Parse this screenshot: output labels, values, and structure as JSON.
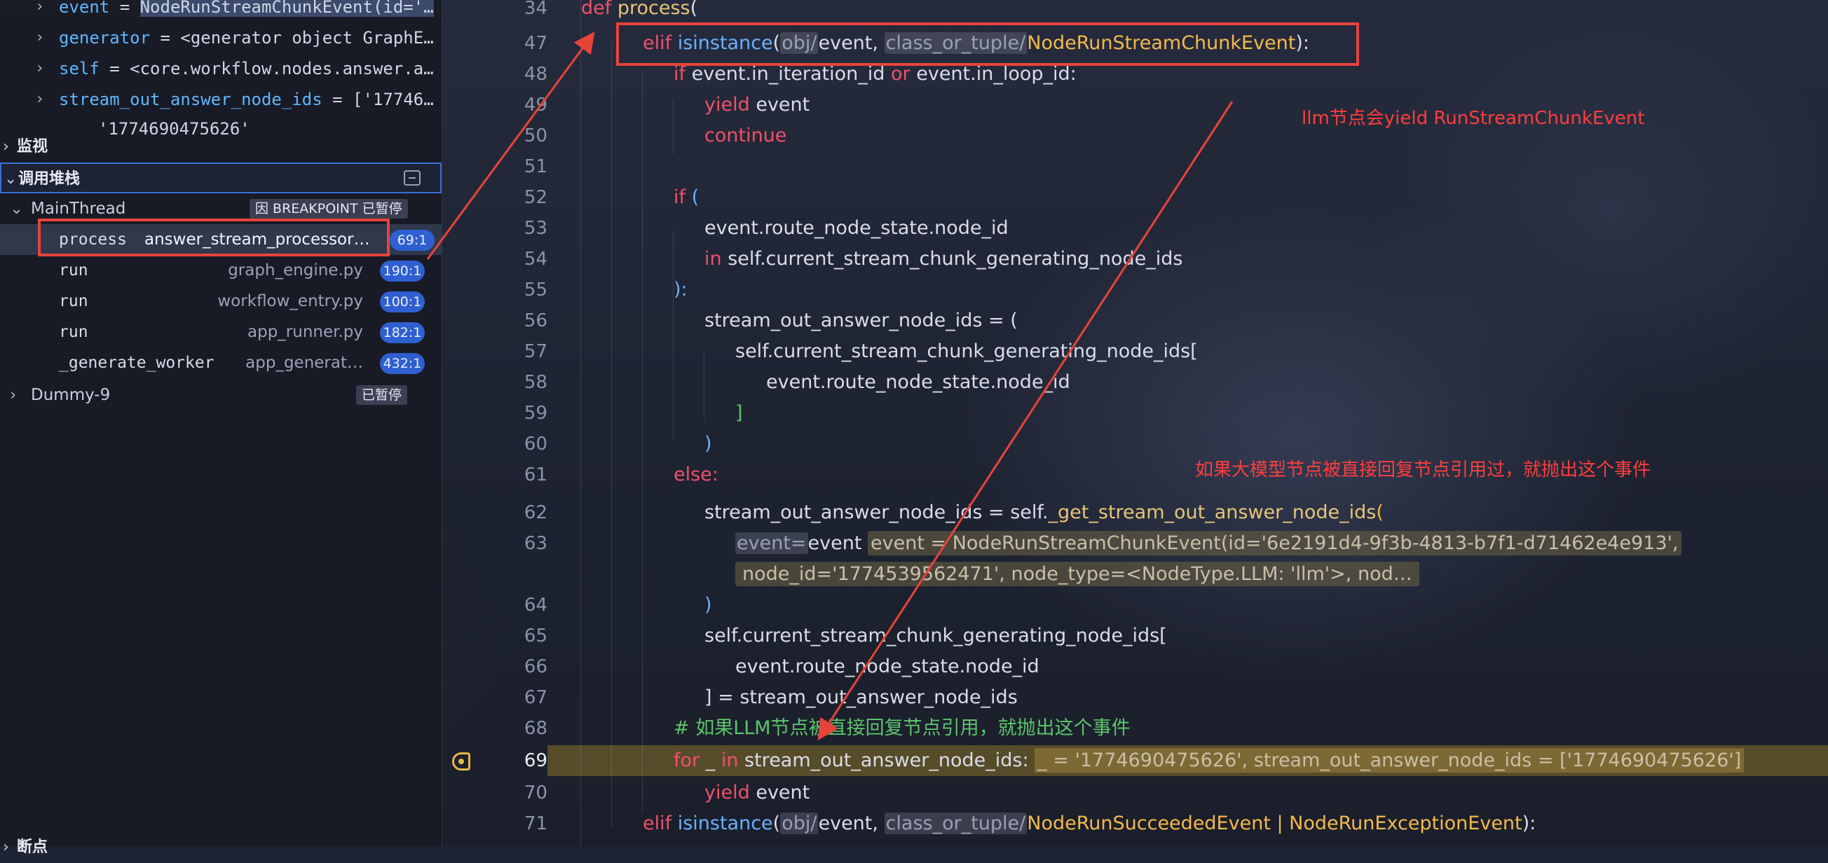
{
  "variables": [
    {
      "name": "event",
      "value": "NodeRunStreamChunkEvent(id='…"
    },
    {
      "name": "generator",
      "value": "<generator object GraphE…"
    },
    {
      "name": "self",
      "value": "<core.workflow.nodes.answer.a…"
    },
    {
      "name": "stream_out_answer_node_ids",
      "value": "['17746…"
    },
    {
      "name": "",
      "value": "'1774690475626'"
    }
  ],
  "sections": {
    "watch": "监视",
    "callstack": "调用堆栈",
    "breakpoints": "断点"
  },
  "threads": {
    "main": {
      "name": "MainThread",
      "status": "因 BREAKPOINT 已暂停"
    },
    "dummy": {
      "name": "Dummy-9",
      "status": "已暂停"
    }
  },
  "frames": [
    {
      "fn": "process",
      "file": "answer_stream_processor…",
      "line": "69:1"
    },
    {
      "fn": "run",
      "file": "graph_engine.py",
      "line": "190:1"
    },
    {
      "fn": "run",
      "file": "workflow_entry.py",
      "line": "100:1"
    },
    {
      "fn": "run",
      "file": "app_runner.py",
      "line": "182:1"
    },
    {
      "fn": "_generate_worker",
      "file": "app_generat…",
      "line": "432:1"
    }
  ],
  "line_numbers": [
    "34",
    "47",
    "48",
    "49",
    "50",
    "51",
    "52",
    "53",
    "54",
    "55",
    "56",
    "57",
    "58",
    "59",
    "60",
    "61",
    "62",
    "63",
    "",
    "64",
    "65",
    "66",
    "67",
    "68",
    "69",
    "70",
    "71"
  ],
  "code": {
    "l34": {
      "kw": "def",
      "fn": "process",
      "rest": "("
    },
    "l47": {
      "kw": "elif",
      "fn": "isinstance",
      "h1": "obj/",
      "a1": "event",
      "h2": "class_or_tuple/",
      "a2": "NodeRunStreamChunkEvent",
      "end": "):"
    },
    "l48": {
      "kw1": "if",
      "a": "event.in_iteration_id",
      "kw2": "or",
      "b": "event.in_loop_id:"
    },
    "l49": {
      "kw": "yield",
      "rest": "event"
    },
    "l50": {
      "kw": "continue"
    },
    "l52": {
      "kw": "if",
      "rest": "("
    },
    "l53": "event.route_node_state.node_id",
    "l54": {
      "kw": "in",
      "rest": "self.current_stream_chunk_generating_node_ids"
    },
    "l55": "):",
    "l56": "stream_out_answer_node_ids = (",
    "l57": "self.current_stream_chunk_generating_node_ids[",
    "l58": "event.route_node_state.node_id",
    "l59": "]",
    "l60": ")",
    "l61": "else:",
    "l62": {
      "a": "stream_out_answer_node_ids = self.",
      "fn": "_get_stream_out_answer_node_ids",
      "end": "("
    },
    "l63": {
      "h": "event=",
      "a": "event",
      "inline": "event = NodeRunStreamChunkEvent(id='6e2191d4-9f3b-4813-b7f1-d71462e4e913',"
    },
    "l63b": "node_id='1774539562471', node_type=<NodeType.LLM: 'llm'>, nod…",
    "l64": ")",
    "l65": "self.current_stream_chunk_generating_node_ids[",
    "l66": "event.route_node_state.node_id",
    "l67": "] = stream_out_answer_node_ids",
    "l68": "# 如果LLM节点被直接回复节点引用，就抛出这个事件",
    "l69": {
      "kw1": "for",
      "a": "_",
      "kw2": "in",
      "b": "stream_out_answer_node_ids:",
      "inline": "_ = '1774690475626', stream_out_answer_node_ids = ['1774690475626']"
    },
    "l70": {
      "kw": "yield",
      "rest": "event"
    },
    "l71": {
      "kw": "elif",
      "fn": "isinstance",
      "h1": "obj/",
      "a1": "event",
      "h2": "class_or_tuple/",
      "a2": "NodeRunSucceededEvent | NodeRunExceptionEvent",
      "end": "):"
    }
  },
  "annotations": {
    "a1": "llm节点会yield RunStreamChunkEvent",
    "a2": "如果大模型节点被直接回复节点引用过，就抛出这个事件"
  },
  "colors": {
    "accent_red": "#e8433b",
    "line_badge": "#2f5fd0"
  }
}
